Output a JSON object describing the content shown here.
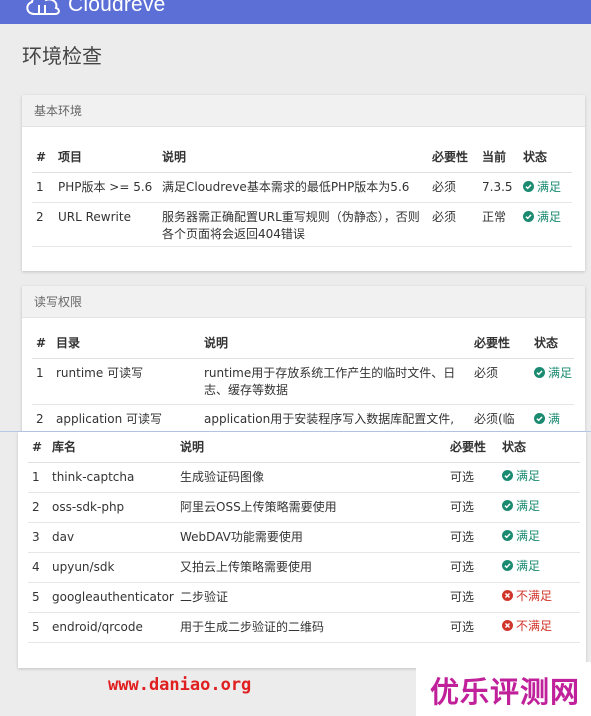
{
  "app": {
    "name": "Cloudreve"
  },
  "page": {
    "title": "环境检查"
  },
  "basic": {
    "header": "基本环境",
    "columns": [
      "#",
      "项目",
      "说明",
      "必要性",
      "当前",
      "状态"
    ],
    "rows": [
      {
        "num": "1",
        "item": "PHP版本 >= 5.6",
        "desc": "满足Cloudreve基本需求的最低PHP版本为5.6",
        "need": "必须",
        "current": "7.3.5",
        "status": "满足",
        "ok": true
      },
      {
        "num": "2",
        "item": "URL Rewrite",
        "desc": "服务器需正确配置URL重写规则（伪静态），否则各个页面将会返回404错误",
        "need": "必须",
        "current": "正常",
        "status": "满足",
        "ok": true
      }
    ]
  },
  "perm": {
    "header": "读写权限",
    "columns": [
      "#",
      "目录",
      "说明",
      "必要性",
      "状态"
    ],
    "rows": [
      {
        "num": "1",
        "dir": "runtime 可读写",
        "desc": "runtime用于存放系统工作产生的临时文件、日志、缓存等数据",
        "need": "必须",
        "status": "满足"
      },
      {
        "num": "2",
        "dir": "application 可读写",
        "desc": "application用于安装程序写入数据库配置文件,",
        "need": "必须(临",
        "status": "满"
      }
    ]
  },
  "libs": {
    "columns": [
      "#",
      "库名",
      "说明",
      "必要性",
      "状态"
    ],
    "rows": [
      {
        "num": "1",
        "name": "think-captcha",
        "desc": "生成验证码图像",
        "need": "可选",
        "status": "满足",
        "ok": true
      },
      {
        "num": "2",
        "name": "oss-sdk-php",
        "desc": "阿里云OSS上传策略需要使用",
        "need": "可选",
        "status": "满足",
        "ok": true
      },
      {
        "num": "3",
        "name": "dav",
        "desc": "WebDAV功能需要使用",
        "need": "可选",
        "status": "满足",
        "ok": true
      },
      {
        "num": "4",
        "name": "upyun/sdk",
        "desc": "又拍云上传策略需要使用",
        "need": "可选",
        "status": "满足",
        "ok": true
      },
      {
        "num": "5",
        "name": "googleauthenticator",
        "desc": "二步验证",
        "need": "可选",
        "status": "不满足",
        "ok": false
      },
      {
        "num": "5",
        "name": "endroid/qrcode",
        "desc": "用于生成二步验证的二维码",
        "need": "可选",
        "status": "不满足",
        "ok": false
      }
    ]
  },
  "watermark": {
    "left": "www.daniao.org",
    "right": "优乐评测网"
  },
  "colors": {
    "topbar": "#5b6fd6",
    "ok": "#1a8a70",
    "bad": "#d0352b"
  }
}
